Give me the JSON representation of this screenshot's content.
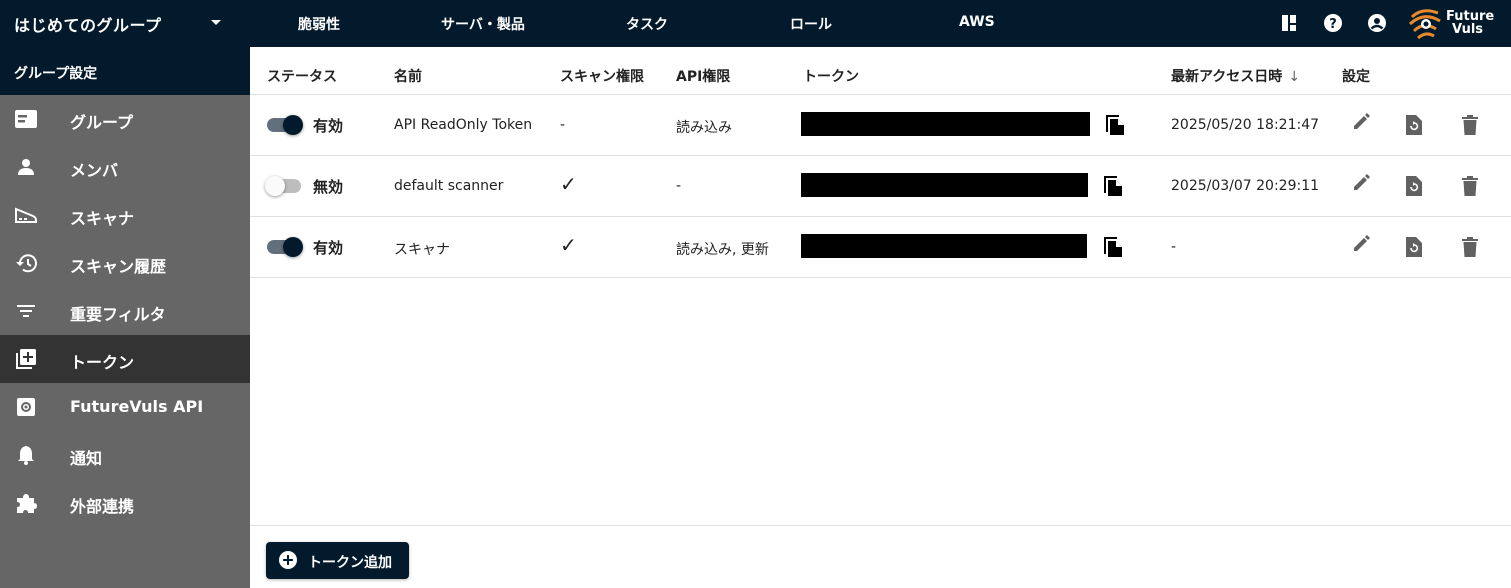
{
  "header": {
    "group_name": "はじめてのグループ",
    "nav": [
      "脆弱性",
      "サーバ・製品",
      "タスク",
      "ロール",
      "AWS"
    ],
    "logo_text_1": "Future",
    "logo_text_2": "Vuls"
  },
  "sidebar": {
    "title": "グループ設定",
    "items": [
      {
        "label": "グループ",
        "icon": "group-card-icon"
      },
      {
        "label": "メンバ",
        "icon": "person-icon"
      },
      {
        "label": "スキャナ",
        "icon": "scanner-icon"
      },
      {
        "label": "スキャン履歴",
        "icon": "history-icon"
      },
      {
        "label": "重要フィルタ",
        "icon": "filter-icon"
      },
      {
        "label": "トークン",
        "icon": "token-add-icon",
        "active": true
      },
      {
        "label": "FutureVuls API",
        "icon": "api-settings-icon"
      },
      {
        "label": "通知",
        "icon": "bell-icon"
      },
      {
        "label": "外部連携",
        "icon": "puzzle-icon"
      }
    ]
  },
  "table": {
    "headers": {
      "status": "ステータス",
      "name": "名前",
      "scan_perm": "スキャン権限",
      "api_perm": "API権限",
      "token": "トークン",
      "last_access": "最新アクセス日時",
      "settings": "設定"
    },
    "sort_arrow": "↓",
    "rows": [
      {
        "enabled": true,
        "status": "有効",
        "name": "API ReadOnly Token",
        "scan_perm": "-",
        "api_perm": "読み込み",
        "last_access": "2025/05/20 18:21:47"
      },
      {
        "enabled": false,
        "status": "無効",
        "name": "default scanner",
        "scan_perm": "✓",
        "api_perm": "-",
        "last_access": "2025/03/07 20:29:11"
      },
      {
        "enabled": true,
        "status": "有効",
        "name": "スキャナ",
        "scan_perm": "✓",
        "api_perm": "読み込み, 更新",
        "last_access": "-"
      }
    ]
  },
  "footer": {
    "add_token_label": "トークン追加"
  },
  "colors": {
    "primary": "#031a2c",
    "sidebar_bg": "#666666",
    "sidebar_active": "#333333",
    "logo_accent": "#e8892b"
  }
}
